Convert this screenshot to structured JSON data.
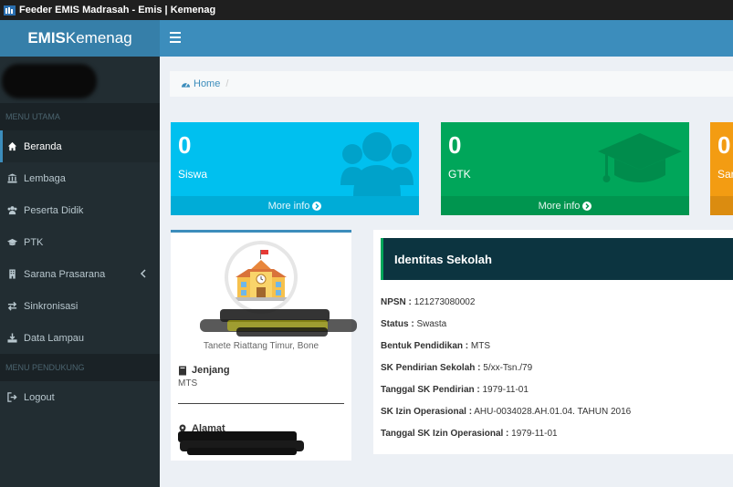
{
  "window": {
    "title": "Feeder EMIS Madrasah - Emis | Kemenag"
  },
  "logo": {
    "bold": "EMIS",
    "light": "Kemenag"
  },
  "sidebar": {
    "section_main": "MENU UTAMA",
    "items": [
      {
        "label": "Beranda",
        "icon": "home-icon"
      },
      {
        "label": "Lembaga",
        "icon": "bank-icon"
      },
      {
        "label": "Peserta Didik",
        "icon": "users-icon"
      },
      {
        "label": "PTK",
        "icon": "graduation-cap-icon"
      },
      {
        "label": "Sarana Prasarana",
        "icon": "building-icon"
      },
      {
        "label": "Sinkronisasi",
        "icon": "exchange-icon"
      },
      {
        "label": "Data Lampau",
        "icon": "download-icon"
      }
    ],
    "section_support": "MENU PENDUKUNG",
    "logout": {
      "label": "Logout",
      "icon": "sign-out-icon"
    }
  },
  "breadcrumb": {
    "home": "Home",
    "separator": "/"
  },
  "stats": [
    {
      "count": "0",
      "label": "Siswa",
      "more": "More info",
      "color": "#00c0ef",
      "icon": "users-icon"
    },
    {
      "count": "0",
      "label": "GTK",
      "more": "More info",
      "color": "#00a65a",
      "icon": "graduation-cap-icon"
    },
    {
      "count": "0",
      "label": "Sar",
      "color": "#f39c12"
    }
  ],
  "profile": {
    "location": "Tanete Riattang Timur, Bone",
    "jenjang_label": "Jenjang",
    "jenjang_value": "MTS",
    "alamat_label": "Alamat"
  },
  "identity": {
    "title": "Identitas Sekolah",
    "fields": [
      {
        "label": "NPSN :",
        "value": "121273080002"
      },
      {
        "label": "Status :",
        "value": "Swasta"
      },
      {
        "label": "Bentuk Pendidikan :",
        "value": "MTS"
      },
      {
        "label": "SK Pendirian Sekolah :",
        "value": "5/xx-Tsn./79"
      },
      {
        "label": "Tanggal SK Pendirian :",
        "value": "1979-11-01"
      },
      {
        "label": "SK Izin Operasional :",
        "value": "AHU-0034028.AH.01.04. TAHUN 2016"
      },
      {
        "label": "Tanggal SK Izin Operasional :",
        "value": "1979-11-01"
      }
    ]
  },
  "colors": {
    "header": "#3c8dbc",
    "logo_bg": "#367fa9",
    "sidebar": "#222d32",
    "identity_head": "#0c3440"
  }
}
